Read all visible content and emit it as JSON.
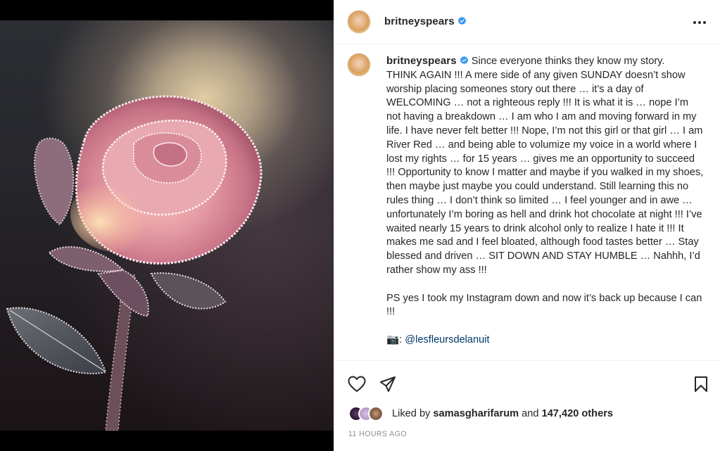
{
  "post": {
    "username": "britneyspears",
    "verified": true,
    "caption_lines": [
      "Since everyone thinks they know my story.",
      "THINK AGAIN !!! A mere side of any given SUNDAY doesn’t show worship placing someones story out there … it’s a day of WELCOMING … not a righteous reply !!! It is what it is … nope I’m not having a breakdown … I am who I am and moving forward in my life. I have never felt better !!! Nope, I’m not this girl or that girl … I am River Red … and being able to volumize my voice in a world where I lost my rights … for 15 years … gives me an opportunity to succeed !!! Opportunity to know I matter and maybe if you walked in my shoes, then maybe just maybe you could understand. Still learning this no rules thing … I don’t think so limited … I feel younger and in awe … unfortunately I’m boring as hell and drink hot chocolate at night !!! I’ve waited nearly 15 years to drink alcohol only to realize I hate it !!! It makes me sad and I feel bloated, although food tastes better … Stay blessed and driven … SIT DOWN AND STAY HUMBLE … Nahhh, I’d rather show my ass !!!"
    ],
    "ps": "PS yes I took my Instagram down and now it’s back up because I can !!!",
    "credit_emoji": "📷:",
    "credit_mention": "@lesfleursdelanuit",
    "liked_by_prefix": "Liked by",
    "liked_by_user": "samasgharifarum",
    "liked_by_and": "and",
    "likes_others": "147,420 others",
    "timestamp": "11 HOURS AGO"
  },
  "icons": {
    "verified": "verified-badge-icon",
    "more": "more-options-icon",
    "like": "heart-icon",
    "share": "paper-plane-icon",
    "save": "bookmark-icon"
  },
  "colors": {
    "verified": "#3897f0",
    "mention": "#00376b",
    "timestamp": "#8e8e8e"
  }
}
